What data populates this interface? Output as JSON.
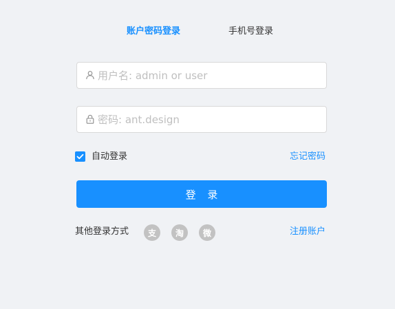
{
  "tabs": [
    {
      "label": "账户密码登录",
      "active": true
    },
    {
      "label": "手机号登录",
      "active": false
    }
  ],
  "username": {
    "placeholder": "用户名: admin or user",
    "value": "",
    "icon": "user-icon"
  },
  "password": {
    "placeholder": "密码: ant.design",
    "value": "",
    "icon": "lock-icon"
  },
  "remember": {
    "label": "自动登录",
    "checked": true
  },
  "forgot_label": "忘记密码",
  "submit_label": "登 录",
  "other_login": {
    "label": "其他登录方式",
    "providers": [
      {
        "name": "alipay-icon",
        "glyph": "支"
      },
      {
        "name": "taobao-icon",
        "glyph": "淘"
      },
      {
        "name": "weibo-icon",
        "glyph": "微"
      }
    ]
  },
  "register_label": "注册账户",
  "colors": {
    "primary": "#1890ff",
    "background": "#f0f2f5",
    "social": "#c2c2c2"
  }
}
